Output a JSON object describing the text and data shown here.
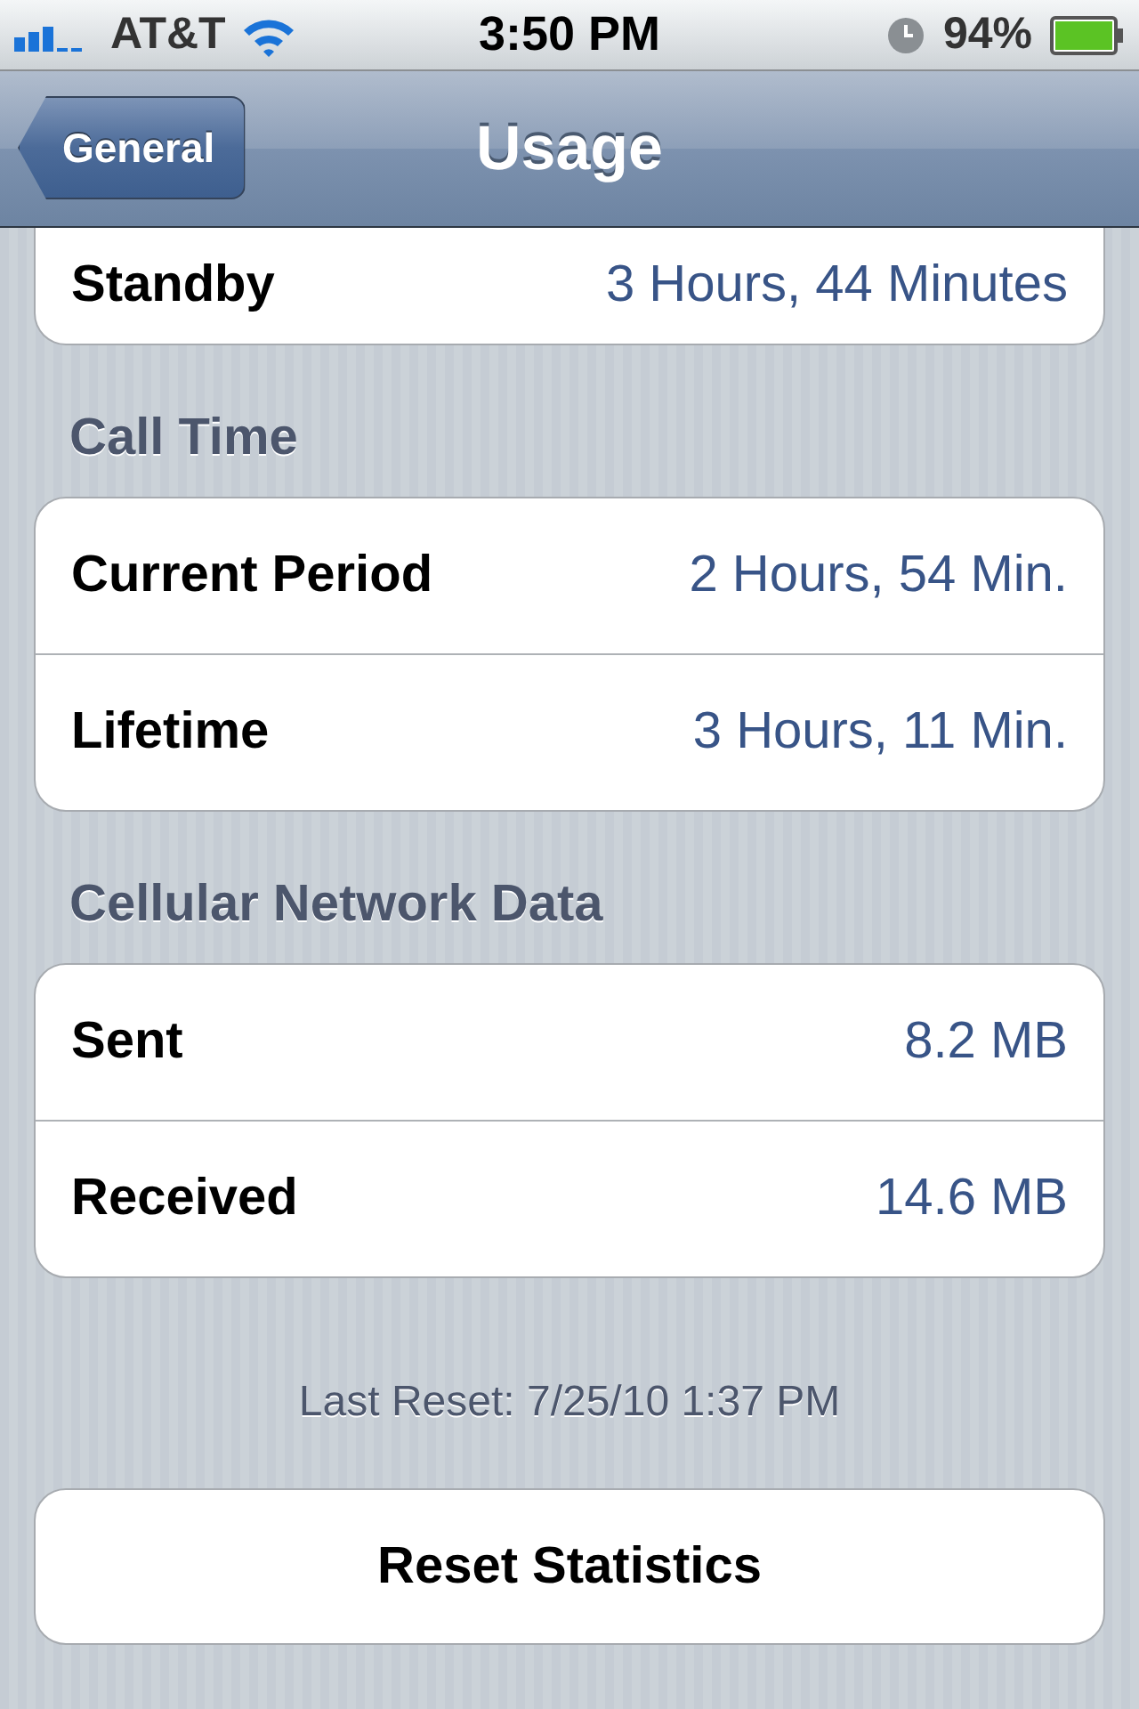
{
  "status_bar": {
    "carrier": "AT&T",
    "time": "3:50 PM",
    "battery": "94%"
  },
  "nav_bar": {
    "back_button": "General",
    "title": "Usage"
  },
  "groups": [
    {
      "rows": [
        {
          "label": "Standby",
          "value": "3 Hours, 44 Minutes"
        }
      ]
    },
    {
      "header": "Call Time",
      "rows": [
        {
          "label": "Current Period",
          "value": "2 Hours, 54 Min."
        },
        {
          "label": "Lifetime",
          "value": "3 Hours, 11 Min."
        }
      ]
    },
    {
      "header": "Cellular Network Data",
      "rows": [
        {
          "label": "Sent",
          "value": "8.2 MB"
        },
        {
          "label": "Received",
          "value": "14.6 MB"
        }
      ]
    }
  ],
  "footer": "Last Reset: 7/25/10 1:37 PM",
  "reset_button": "Reset Statistics"
}
